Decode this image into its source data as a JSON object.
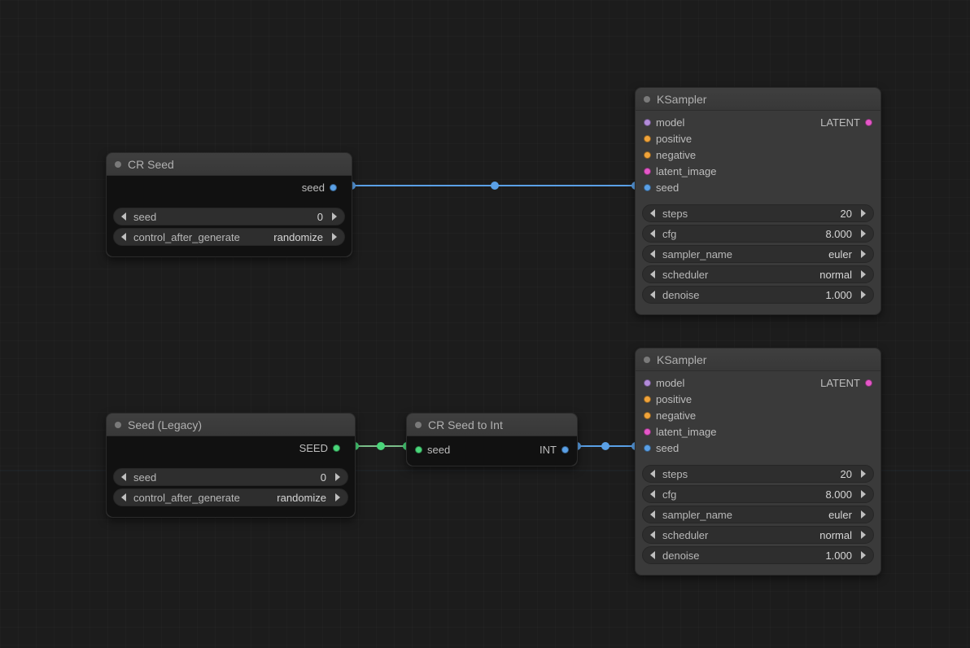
{
  "colors": {
    "port_blue": "#5aa0e6",
    "port_green": "#4ad67a",
    "port_purple": "#b28bd9",
    "port_orange": "#f0a33a",
    "port_magenta": "#e557c8"
  },
  "wires": [
    {
      "from": "cr_seed.out.seed",
      "to": "ksampler1.in.seed",
      "color": "#5aa0e6"
    },
    {
      "from": "seed_legacy.out.SEED",
      "to": "cr_seed_to_int.in.seed",
      "color": "#4ad67a"
    },
    {
      "from": "cr_seed_to_int.out.INT",
      "to": "ksampler2.in.seed",
      "color": "#5aa0e6"
    }
  ],
  "nodes": {
    "cr_seed": {
      "title": "CR Seed",
      "outputs": [
        {
          "name": "seed",
          "color": "port_blue"
        }
      ],
      "widgets": {
        "seed": {
          "label": "seed",
          "value": "0"
        },
        "control_after_generate": {
          "label": "control_after_generate",
          "value": "randomize"
        }
      }
    },
    "seed_legacy": {
      "title": "Seed (Legacy)",
      "outputs": [
        {
          "name": "SEED",
          "color": "port_green"
        }
      ],
      "widgets": {
        "seed": {
          "label": "seed",
          "value": "0"
        },
        "control_after_generate": {
          "label": "control_after_generate",
          "value": "randomize"
        }
      }
    },
    "cr_seed_to_int": {
      "title": "CR Seed to Int",
      "inputs": [
        {
          "name": "seed",
          "color": "port_green"
        }
      ],
      "outputs": [
        {
          "name": "INT",
          "color": "port_blue"
        }
      ]
    },
    "ksampler1": {
      "title": "KSampler",
      "inputs": [
        {
          "name": "model",
          "color": "port_purple"
        },
        {
          "name": "positive",
          "color": "port_orange"
        },
        {
          "name": "negative",
          "color": "port_orange"
        },
        {
          "name": "latent_image",
          "color": "port_magenta"
        },
        {
          "name": "seed",
          "color": "port_blue"
        }
      ],
      "outputs": [
        {
          "name": "LATENT",
          "color": "port_magenta"
        }
      ],
      "widgets": {
        "steps": {
          "label": "steps",
          "value": "20"
        },
        "cfg": {
          "label": "cfg",
          "value": "8.000"
        },
        "sampler_name": {
          "label": "sampler_name",
          "value": "euler"
        },
        "scheduler": {
          "label": "scheduler",
          "value": "normal"
        },
        "denoise": {
          "label": "denoise",
          "value": "1.000"
        }
      }
    },
    "ksampler2": {
      "title": "KSampler",
      "inputs": [
        {
          "name": "model",
          "color": "port_purple"
        },
        {
          "name": "positive",
          "color": "port_orange"
        },
        {
          "name": "negative",
          "color": "port_orange"
        },
        {
          "name": "latent_image",
          "color": "port_magenta"
        },
        {
          "name": "seed",
          "color": "port_blue"
        }
      ],
      "outputs": [
        {
          "name": "LATENT",
          "color": "port_magenta"
        }
      ],
      "widgets": {
        "steps": {
          "label": "steps",
          "value": "20"
        },
        "cfg": {
          "label": "cfg",
          "value": "8.000"
        },
        "sampler_name": {
          "label": "sampler_name",
          "value": "euler"
        },
        "scheduler": {
          "label": "scheduler",
          "value": "normal"
        },
        "denoise": {
          "label": "denoise",
          "value": "1.000"
        }
      }
    }
  }
}
